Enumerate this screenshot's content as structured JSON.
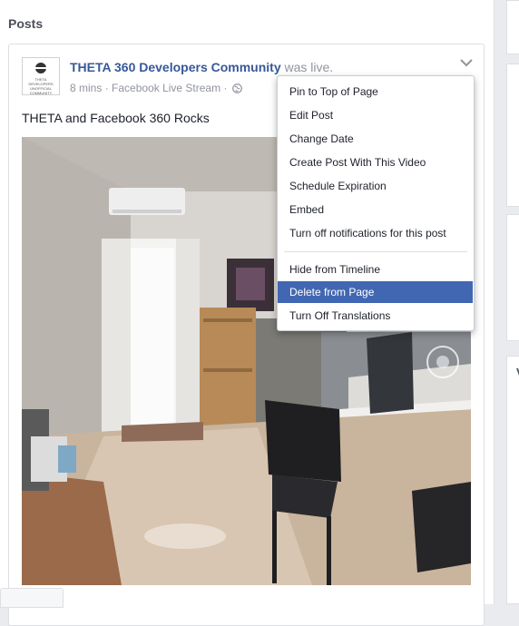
{
  "panel": {
    "title": "Posts"
  },
  "post": {
    "page_name": "THETA 360 Developers Community",
    "status_suffix": "was live.",
    "time": "8 mins",
    "separator": "·",
    "source": "Facebook Live Stream",
    "visibility_icon": "globe-icon",
    "body_text": "THETA and Facebook 360 Rocks",
    "avatar_text": "THETA DEVELOPERS UNOFFICIAL COMMUNITY",
    "options_icon": "chevron-down-icon",
    "video_control_icon": "360-view-icon"
  },
  "menu": {
    "items": [
      {
        "label": "Pin to Top of Page"
      },
      {
        "label": "Edit Post"
      },
      {
        "label": "Change Date"
      },
      {
        "label": "Create Post With This Video"
      },
      {
        "label": "Schedule Expiration"
      },
      {
        "label": "Embed"
      },
      {
        "label": "Turn off notifications for this post"
      },
      {
        "label": "Hide from Timeline"
      },
      {
        "label": "Delete from Page",
        "selected": true
      },
      {
        "label": "Turn Off Translations"
      }
    ]
  },
  "right_column": {
    "partial_letter": "V"
  },
  "colors": {
    "link": "#365899",
    "menu_highlight": "#4267b2",
    "muted": "#90949c",
    "background": "#e9ebee"
  }
}
